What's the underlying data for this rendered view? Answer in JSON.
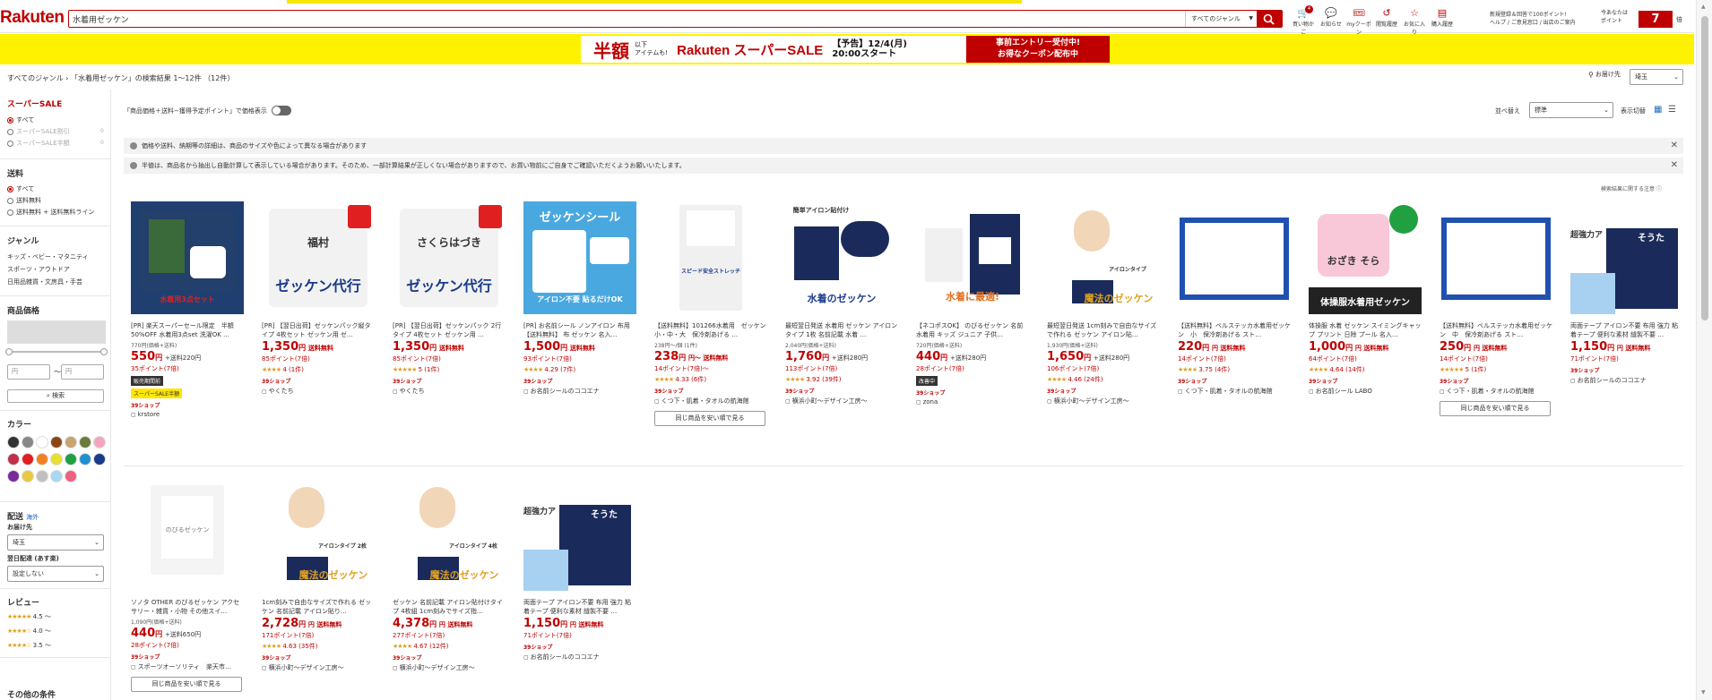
{
  "header": {
    "logo": "Rakuten",
    "search_value": "水着用ゼッケン",
    "genre_select": "すべてのジャンル",
    "icons": [
      {
        "name": "cart-icon",
        "label": "買い物かご",
        "glyph": "🛒",
        "badge": "4"
      },
      {
        "name": "notification-icon",
        "label": "お知らせ",
        "glyph": "💬",
        "badge": ""
      },
      {
        "name": "coupon-icon",
        "label": "myクーポン",
        "glyph": "🎟",
        "badge": ""
      },
      {
        "name": "history-icon",
        "label": "閲覧履歴",
        "glyph": "↺",
        "badge": ""
      },
      {
        "name": "star-icon",
        "label": "お気に入り",
        "glyph": "☆",
        "badge": ""
      },
      {
        "name": "purchase-history-icon",
        "label": "購入履歴",
        "glyph": "▤",
        "badge": ""
      }
    ],
    "top_notice_line1": "新規登録＆回答で100ポイント!",
    "top_notice_line2": "ヘルプ / ご意見窓口 / 出店のご案内",
    "points_label_line1": "今あなたは",
    "points_label_line2": "ポイント",
    "points_value": "7",
    "points_unit": "倍"
  },
  "banner": {
    "big": "半額",
    "small_line1": "以下",
    "small_line2": "アイテムも!",
    "brand": "Rakuten スーパーSALE",
    "date_line1": "【予告】12/4(月)",
    "date_line2": "20:00スタート",
    "cta_line1": "事前エントリー受付中!",
    "cta_line2": "お得なクーポン配布中"
  },
  "breadcrumb": {
    "root": "すべてのジャンル",
    "sep": "›",
    "result": "「水着用ゼッケン」の検索結果 1～12件 （12件）"
  },
  "ship_to": {
    "label": "お届け先",
    "value": "埼玉"
  },
  "sidebar": {
    "super_sale": {
      "heading": "スーパーSALE",
      "items": [
        "すべて",
        "スーパーSALE割引",
        "スーパーSALE半額"
      ],
      "counts": [
        "",
        "0",
        "0"
      ]
    },
    "shipping": {
      "heading": "送料",
      "items": [
        "すべて",
        "送料無料",
        "送料無料 + 送料無料ライン"
      ]
    },
    "genre": {
      "heading": "ジャンル",
      "items": [
        "キッズ・ベビー・マタニティ",
        "スポーツ・アウトドア",
        "日用品雑貨・文房具・手芸"
      ]
    },
    "price": {
      "heading": "商品価格",
      "min_placeholder": "円",
      "max_placeholder": "円",
      "tilde": "～",
      "search_button": "検索"
    },
    "color": {
      "heading": "カラー",
      "swatches": [
        "#333333",
        "#888888",
        "#ffffff",
        "#8b4513",
        "#c8a46e",
        "#6b7b3a",
        "#f4a6c1",
        "#c0304a",
        "#e02020",
        "#f08020",
        "#e8e030",
        "#20a040",
        "#2090d0",
        "#1a3a8a",
        "#7a2a9a",
        "#e8c840",
        "#c0c0c0",
        "#a8d8f0",
        "#f06080"
      ]
    },
    "delivery": {
      "heading": "配送",
      "overseas": "海外",
      "dest_label": "お届け先",
      "dest_value": "埼玉",
      "date_label": "翌日配達 (あす楽)",
      "date_value": "設定しない"
    },
    "review": {
      "heading": "レビュー",
      "items": [
        "4.5 ～",
        "4.0 ～",
        "3.5 ～"
      ]
    },
    "other": {
      "heading": "その他の条件"
    }
  },
  "main": {
    "toggle_label": "「商品価格＋送料−獲得予定ポイント」で価格表示",
    "sort_label": "並べ替え",
    "sort_value": "標準",
    "view_label": "表示切替",
    "notices": [
      "価格や送料、納期等の詳細は、商品のサイズや色によって異なる場合があります",
      "半値は、商品名から抽出し自動計算して表示している場合があります。そのため、一部計算結果が正しくない場合がありますので、お買い物前にご自身でご確認いただくようお願いいたします。"
    ],
    "rank_note": "検索結果に関する注意",
    "similar_button": "同じ商品を安い順で見る"
  },
  "products": [
    {
      "title": "[PR] 楽天スーパーセール限定　半額50%OFF 水着用3点set 洗濯OK …",
      "orig": "770円(価格+送料)",
      "price": "550",
      "ship": "+送料220円",
      "pts": "35ポイント(7倍)",
      "rating": "",
      "reviews": "",
      "tag": "販売期間前",
      "tag2": "スーパーSALE半額",
      "shop39": "39ショップ",
      "shop": "krstore",
      "similar": false
    },
    {
      "title": "[PR] 【翌日出荷】ゼッケンパック縦タイプ 4枚セット ゼッケン用 ゼ…",
      "orig": "",
      "price": "1,350",
      "ship": "送料無料",
      "pts": "85ポイント(7倍)",
      "rating": "★★★★",
      "reviews": "4 (1件)",
      "tag": "",
      "tag2": "",
      "shop39": "39ショップ",
      "shop": "やくたち",
      "similar": false
    },
    {
      "title": "[PR] 【翌日出荷】ゼッケンパック 2行タイプ 4枚セット ゼッケン用 …",
      "orig": "",
      "price": "1,350",
      "ship": "送料無料",
      "pts": "85ポイント(7倍)",
      "rating": "★★★★★",
      "reviews": "5 (1件)",
      "tag": "",
      "tag2": "",
      "shop39": "39ショップ",
      "shop": "やくたち",
      "similar": false
    },
    {
      "title": "[PR] お名前シール ノンアイロン 布用 【送料無料】 布 ゼッケン 名入…",
      "orig": "",
      "price": "1,500",
      "ship": "送料無料",
      "pts": "93ポイント(7倍)",
      "rating": "★★★★",
      "reviews": "4.29 (7件)",
      "tag": "",
      "tag2": "",
      "shop39": "39ショップ",
      "shop": "お名前シールのココエナ",
      "similar": false
    },
    {
      "title": "【送料無料】101266水着用　ゼッケン　小・中・大　保冷剤あげる …",
      "orig": "238円～/個 (1件)",
      "price": "238",
      "ship": "円～ 送料無料",
      "pts": "14ポイント(7倍)～",
      "rating": "★★★★",
      "reviews": "4.33 (6件)",
      "tag": "",
      "tag2": "",
      "shop39": "39ショップ",
      "shop": "くつ下・肌着・タオルの航海館",
      "similar": true
    },
    {
      "title": "最短翌日発送 水着用 ゼッケン アイロン タイプ 1枚 名前記載 水着 …",
      "orig": "2,040円(価格+送料)",
      "price": "1,760",
      "ship": "+送料280円",
      "pts": "113ポイント(7倍)",
      "rating": "★★★★",
      "reviews": "3.92 (39件)",
      "tag": "",
      "tag2": "",
      "shop39": "39ショップ",
      "shop": "横浜小町～デザイン工房～",
      "similar": false
    },
    {
      "title": "【ネコポスOK】 のびるゼッケン 名前 水着用 キッズ ジュニア 子供…",
      "orig": "720円(価格+送料)",
      "price": "440",
      "ship": "+送料280円",
      "pts": "28ポイント(7倍)",
      "rating": "",
      "reviews": "",
      "tag": "改善中",
      "tag2": "",
      "shop39": "39ショップ",
      "shop": "zona",
      "similar": false
    },
    {
      "title": "最短翌日発送 1cm刻みで自由なサイズで作れる ゼッケン アイロン貼…",
      "orig": "1,930円(価格+送料)",
      "price": "1,650",
      "ship": "+送料280円",
      "pts": "106ポイント(7倍)",
      "rating": "★★★★",
      "reviews": "4.46 (24件)",
      "tag": "",
      "tag2": "",
      "shop39": "39ショップ",
      "shop": "横浜小町～デザイン工房～",
      "similar": false
    },
    {
      "title": "【送料無料】ベルステッカ水着用ゼッケン　小　保冷剤あげる スト…",
      "orig": "",
      "price": "220",
      "ship": "円 送料無料",
      "pts": "14ポイント(7倍)",
      "rating": "★★★★",
      "reviews": "3.75 (4件)",
      "tag": "",
      "tag2": "",
      "shop39": "39ショップ",
      "shop": "くつ下・肌着・タオルの航海館",
      "similar": false
    },
    {
      "title": "体操服 水着 ゼッケン スイミングキャップ プリント 日除 プール 名入…",
      "orig": "",
      "price": "1,000",
      "ship": "円 送料無料",
      "pts": "64ポイント(7倍)",
      "rating": "★★★★",
      "reviews": "4.64 (14件)",
      "tag": "",
      "tag2": "",
      "shop39": "39ショップ",
      "shop": "お名前シール LABO",
      "similar": false
    },
    {
      "title": "【送料無料】ベルステッカ水着用ゼッケン　中　保冷剤あげる スト…",
      "orig": "",
      "price": "250",
      "ship": "円 送料無料",
      "pts": "14ポイント(7倍)",
      "rating": "★★★★★",
      "reviews": "5 (1件)",
      "tag": "",
      "tag2": "",
      "shop39": "39ショップ",
      "shop": "くつ下・肌着・タオルの航海館",
      "similar": true
    },
    {
      "title": "両面テープ アイロン不要 布用 強力 粘着テープ 便利な素材 縫製不要 …",
      "orig": "",
      "price": "1,150",
      "ship": "円 送料無料",
      "pts": "71ポイント(7倍)",
      "rating": "",
      "reviews": "",
      "tag": "",
      "tag2": "",
      "shop39": "39ショップ",
      "shop": "お名前シールのココエナ",
      "similar": false
    },
    {
      "title": "ソノタ OTHER のびるゼッケン アクセサリー・雑貨・小物 その他スイ…",
      "orig": "1,090円(価格+送料)",
      "price": "440",
      "ship": "+送料650円",
      "pts": "28ポイント(7倍)",
      "rating": "",
      "reviews": "",
      "tag": "",
      "tag2": "",
      "shop39": "39ショップ",
      "shop": "スポーツオーソリティ　楽天市…",
      "similar": true
    },
    {
      "title": "1cm刻みで自由なサイズで作れる ゼッケン 名前記載 アイロン貼り…",
      "orig": "",
      "price": "2,728",
      "ship": "円 送料無料",
      "pts": "171ポイント(7倍)",
      "rating": "★★★★",
      "reviews": "4.63 (35件)",
      "tag": "",
      "tag2": "",
      "shop39": "39ショップ",
      "shop": "横浜小町～デザイン工房～",
      "similar": false
    },
    {
      "title": "ゼッケン 名前記載 アイロン貼付けタイプ 4枚組 1cm刻みでサイズ指…",
      "orig": "",
      "price": "4,378",
      "ship": "円 送料無料",
      "pts": "277ポイント(7倍)",
      "rating": "★★★★",
      "reviews": "4.67 (12件)",
      "tag": "",
      "tag2": "",
      "shop39": "39ショップ",
      "shop": "横浜小町～デザイン工房～",
      "similar": false
    },
    {
      "title": "両面テープ アイロン不要 布用 強力 粘着テープ 便利な素材 縫製不要 …",
      "orig": "",
      "price": "1,150",
      "ship": "円 送料無料",
      "pts": "71ポイント(7倍)",
      "rating": "",
      "reviews": "",
      "tag": "",
      "tag2": "",
      "shop39": "39ショップ",
      "shop": "お名前シールのココエナ",
      "similar": false
    }
  ],
  "product_images": [
    {
      "text": "水着用3点セット",
      "bg": "#1f3f70",
      "fg": "#ffffff",
      "accent": "#e02020"
    },
    {
      "text": "ゼッケン代行",
      "bg": "#ffffff",
      "fg": "#1a3a8a",
      "accent": "#e02020",
      "sub": "福村"
    },
    {
      "text": "ゼッケン代行",
      "bg": "#ffffff",
      "fg": "#1a3a8a",
      "accent": "#e02020",
      "sub": "さくらはづき"
    },
    {
      "text": "ゼッケンシール",
      "bg": "#4aa8e0",
      "fg": "#ffffff",
      "accent": "#ffffff",
      "sub": "アイロン不要 貼るだけOK"
    },
    {
      "text": "スピード安全ストレッチ",
      "bg": "#ffffff",
      "fg": "#1a3a8a",
      "accent": "#d0e0f0",
      "sub": ""
    },
    {
      "text": "水着のゼッケン",
      "bg": "#ffffff",
      "fg": "#1a3a8a",
      "accent": "#1a2a5a",
      "sub": "簡単アイロン貼付け"
    },
    {
      "text": "のびるゼッケン",
      "bg": "#ffffff",
      "fg": "#e07020",
      "accent": "#1a2a5a",
      "sub": "水着に最適!"
    },
    {
      "text": "魔法のゼッケン",
      "bg": "#ffffff",
      "fg": "#e0a020",
      "accent": "#1a2a5a",
      "sub": "アイロンタイプ"
    },
    {
      "text": "",
      "bg": "#ffffff",
      "fg": "#2050b0",
      "accent": "#2050b0",
      "sub": ""
    },
    {
      "text": "体操服水着用ゼッケン",
      "bg": "#ffffff",
      "fg": "#333333",
      "accent": "#20a040",
      "sub": "おざき そら"
    },
    {
      "text": "",
      "bg": "#ffffff",
      "fg": "#2050b0",
      "accent": "#2050b0",
      "sub": ""
    },
    {
      "text": "そうた",
      "bg": "#ffffff",
      "fg": "#1a3a8a",
      "accent": "#1a2a5a",
      "sub": "超強力アイロン不要"
    },
    {
      "text": "のびるゼッケン",
      "bg": "#ffffff",
      "fg": "#333333",
      "accent": "#dddddd",
      "sub": ""
    },
    {
      "text": "魔法のゼッケン",
      "bg": "#ffffff",
      "fg": "#e0a020",
      "accent": "#1a2a5a",
      "sub": "アイロンタイプ 2枚"
    },
    {
      "text": "魔法のゼッケン",
      "bg": "#ffffff",
      "fg": "#e0a020",
      "accent": "#1a2a5a",
      "sub": "アイロンタイプ 4枚"
    },
    {
      "text": "そうた",
      "bg": "#ffffff",
      "fg": "#1a3a8a",
      "accent": "#1a2a5a",
      "sub": "超強力アイロン不要"
    }
  ]
}
